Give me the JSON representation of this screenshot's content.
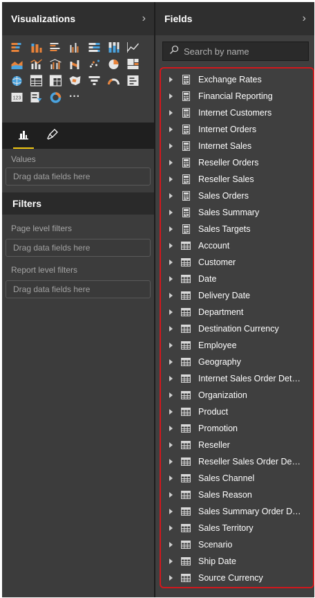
{
  "visualizations": {
    "title": "Visualizations",
    "icons": [
      "stacked-bar-chart-icon",
      "stacked-column-chart-icon",
      "clustered-bar-chart-icon",
      "clustered-column-chart-icon",
      "100-stacked-bar-chart-icon",
      "100-stacked-column-chart-icon",
      "line-chart-icon",
      "area-chart-icon",
      "line-stacked-column-chart-icon",
      "line-clustered-column-chart-icon",
      "ribbon-chart-icon",
      "scatter-chart-icon",
      "pie-chart-icon",
      "treemap-icon",
      "map-icon",
      "table-icon",
      "matrix-icon",
      "filled-map-icon",
      "funnel-icon",
      "gauge-icon",
      "multi-row-card-icon",
      "card-icon",
      "slicer-icon",
      "donut-chart-icon",
      "more-visuals-icon"
    ],
    "more_glyph": "···",
    "values_label": "Values",
    "drop_placeholder": "Drag data fields here"
  },
  "filters": {
    "title": "Filters",
    "page_level_label": "Page level filters",
    "report_level_label": "Report level filters",
    "drop_placeholder": "Drag data fields here"
  },
  "fields": {
    "title": "Fields",
    "search_placeholder": "Search by name",
    "items": [
      {
        "label": "Exchange Rates",
        "kind": "calculator"
      },
      {
        "label": "Financial Reporting",
        "kind": "calculator"
      },
      {
        "label": "Internet Customers",
        "kind": "calculator"
      },
      {
        "label": "Internet Orders",
        "kind": "calculator"
      },
      {
        "label": "Internet Sales",
        "kind": "calculator"
      },
      {
        "label": "Reseller Orders",
        "kind": "calculator"
      },
      {
        "label": "Reseller Sales",
        "kind": "calculator"
      },
      {
        "label": "Sales Orders",
        "kind": "calculator"
      },
      {
        "label": "Sales Summary",
        "kind": "calculator"
      },
      {
        "label": "Sales Targets",
        "kind": "calculator"
      },
      {
        "label": "Account",
        "kind": "table"
      },
      {
        "label": "Customer",
        "kind": "table"
      },
      {
        "label": "Date",
        "kind": "table"
      },
      {
        "label": "Delivery Date",
        "kind": "table"
      },
      {
        "label": "Department",
        "kind": "table"
      },
      {
        "label": "Destination Currency",
        "kind": "table"
      },
      {
        "label": "Employee",
        "kind": "table"
      },
      {
        "label": "Geography",
        "kind": "table"
      },
      {
        "label": "Internet Sales Order Details",
        "kind": "table"
      },
      {
        "label": "Organization",
        "kind": "table"
      },
      {
        "label": "Product",
        "kind": "table"
      },
      {
        "label": "Promotion",
        "kind": "table"
      },
      {
        "label": "Reseller",
        "kind": "table"
      },
      {
        "label": "Reseller Sales Order Details",
        "kind": "table"
      },
      {
        "label": "Sales Channel",
        "kind": "table"
      },
      {
        "label": "Sales Reason",
        "kind": "table"
      },
      {
        "label": "Sales Summary Order Det...",
        "kind": "table"
      },
      {
        "label": "Sales Territory",
        "kind": "table"
      },
      {
        "label": "Scenario",
        "kind": "table"
      },
      {
        "label": "Ship Date",
        "kind": "table"
      },
      {
        "label": "Source Currency",
        "kind": "table"
      }
    ]
  },
  "colors": {
    "accent_tab": "#f2c811",
    "highlight_border": "#d3171c",
    "viz_orange": "#e8833a",
    "viz_blue": "#4aa3df"
  }
}
